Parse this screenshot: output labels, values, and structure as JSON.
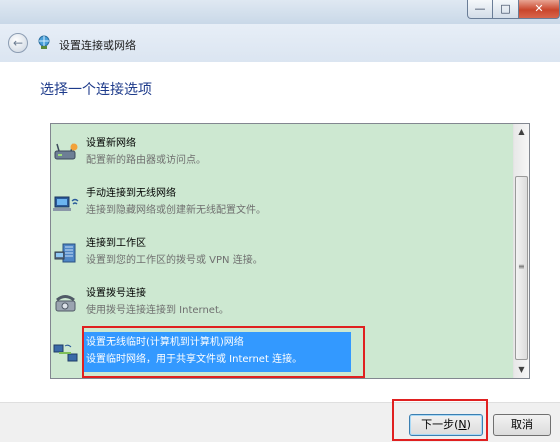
{
  "window": {
    "minimize_glyph": "—",
    "maximize_glyph": "□",
    "close_glyph": "✕"
  },
  "nav": {
    "back_glyph": "←",
    "wizard_title": "设置连接或网络",
    "wizard_icon": "network-globe-icon"
  },
  "heading": "选择一个连接选项",
  "options": [
    {
      "title": "设置新网络",
      "description": "配置新的路由器或访问点。",
      "icon": "router-icon"
    },
    {
      "title": "手动连接到无线网络",
      "description": "连接到隐藏网络或创建新无线配置文件。",
      "icon": "wireless-computer-icon"
    },
    {
      "title": "连接到工作区",
      "description": "设置到您的工作区的拨号或 VPN 连接。",
      "icon": "workplace-building-icon"
    },
    {
      "title": "设置拨号连接",
      "description": "使用拨号连接连接到 Internet。",
      "icon": "dialup-phone-icon"
    },
    {
      "title": "设置无线临时(计算机到计算机)网络",
      "description": "设置临时网络，用于共享文件或 Internet 连接。",
      "icon": "adhoc-network-icon",
      "selected": true
    }
  ],
  "scrollbar": {
    "up_glyph": "▲",
    "down_glyph": "▼",
    "grip_glyph": "≡"
  },
  "buttons": {
    "next_prefix": "下一步(",
    "next_key": "N",
    "next_suffix": ")",
    "cancel": "取消"
  },
  "colors": {
    "list_bg": "#cde8d1",
    "selection": "#3399ff",
    "heading": "#1e3b8b",
    "highlight_frame": "#e02020"
  }
}
